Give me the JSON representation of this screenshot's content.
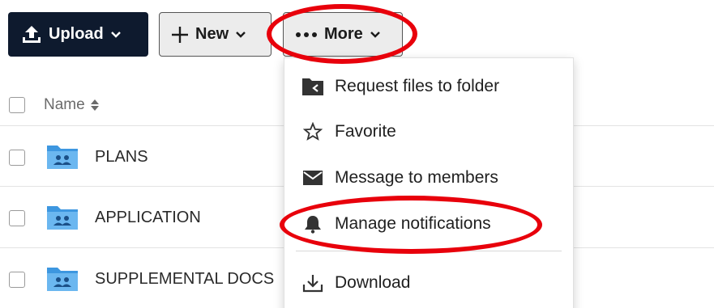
{
  "toolbar": {
    "upload_label": "Upload",
    "new_label": "New",
    "more_label": "More"
  },
  "list": {
    "header_name": "Name",
    "rows": [
      {
        "name": "PLANS"
      },
      {
        "name": "APPLICATION"
      },
      {
        "name": "SUPPLEMENTAL DOCS"
      }
    ]
  },
  "menu": {
    "items": [
      {
        "label": "Request files to folder",
        "icon": "folder-request-icon"
      },
      {
        "label": "Favorite",
        "icon": "star-icon"
      },
      {
        "label": "Message to members",
        "icon": "envelope-icon"
      },
      {
        "label": "Manage notifications",
        "icon": "bell-icon"
      },
      {
        "label": "Download",
        "icon": "download-icon"
      }
    ]
  },
  "colors": {
    "upload_bg": "#0e1a2e",
    "folder_blue": "#4aa3e8",
    "annotation_red": "#e8000b"
  }
}
